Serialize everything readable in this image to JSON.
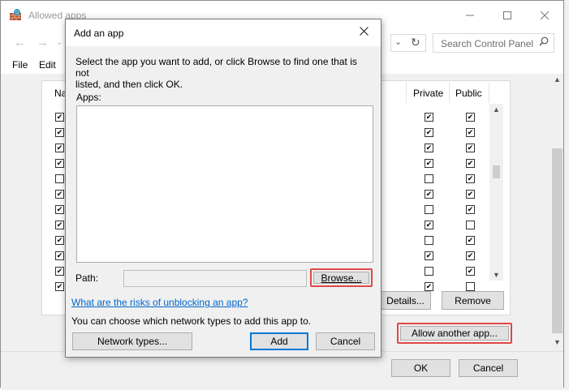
{
  "window": {
    "title": "Allowed apps",
    "search_placeholder": "Search Control Panel",
    "menu": [
      "File",
      "Edit"
    ]
  },
  "list": {
    "header_name": "Na",
    "header_private": "Private",
    "header_public": "Public",
    "rows": [
      {
        "checked": true,
        "private": true,
        "public": true
      },
      {
        "checked": true,
        "private": true,
        "public": true
      },
      {
        "checked": true,
        "private": true,
        "public": true
      },
      {
        "checked": true,
        "private": true,
        "public": true
      },
      {
        "checked": false,
        "private": false,
        "public": true
      },
      {
        "checked": true,
        "private": true,
        "public": true
      },
      {
        "checked": true,
        "private": false,
        "public": true
      },
      {
        "checked": true,
        "private": true,
        "public": false
      },
      {
        "checked": true,
        "private": false,
        "public": true
      },
      {
        "checked": true,
        "private": true,
        "public": true
      },
      {
        "checked": true,
        "private": false,
        "public": true
      },
      {
        "checked": true,
        "private": true,
        "public": false
      }
    ]
  },
  "buttons": {
    "details": "Details...",
    "remove": "Remove",
    "allow_another": "Allow another app...",
    "ok": "OK",
    "cancel": "Cancel"
  },
  "dialog": {
    "title": "Add an app",
    "instruction_line1": "Select the app you want to add, or click Browse to find one that is not",
    "instruction_line2": "listed, and then click OK.",
    "apps_label": "Apps:",
    "path_label": "Path:",
    "path_value": "",
    "browse": "Browse...",
    "risks_link": "What are the risks of unblocking an app?",
    "network_note": "You can choose which network types to add this app to.",
    "network_types": "Network types...",
    "add": "Add",
    "cancel": "Cancel"
  },
  "icons": {
    "app": "firewall-icon",
    "minimize": "minimize-icon",
    "maximize": "maximize-icon",
    "close": "close-icon",
    "back": "back-arrow-icon",
    "forward": "forward-arrow-icon",
    "refresh": "refresh-icon",
    "search": "search-icon"
  },
  "colors": {
    "highlight_border": "#e04848",
    "link": "#0066cc",
    "primary_button_border": "#0078d7"
  }
}
